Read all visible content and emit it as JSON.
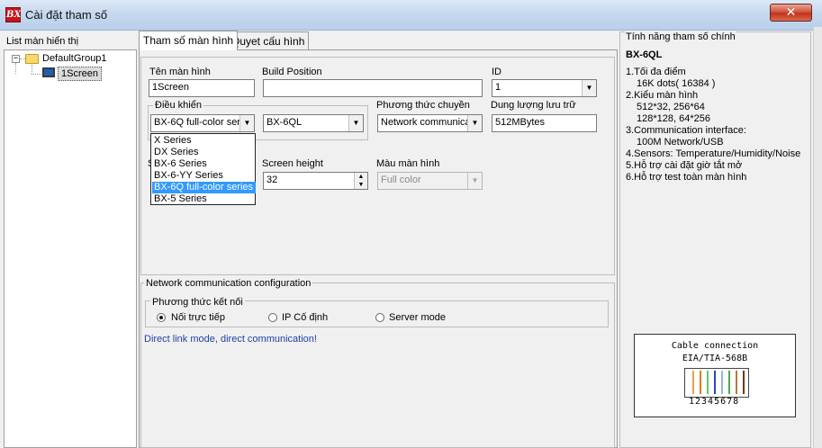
{
  "window": {
    "title": "Cài đặt tham số",
    "close_label": "✕",
    "app_icon_text": "BX"
  },
  "tree": {
    "label": "List màn hiển thị",
    "group": "DefaultGroup1",
    "screen": "1Screen",
    "collapse_glyph": "−"
  },
  "tabs": [
    {
      "label": "Tham số màn hình"
    },
    {
      "label": "Quyet cấu hình"
    }
  ],
  "form": {
    "screen_name": {
      "label": "Tên màn hình",
      "value": "1Screen"
    },
    "build_position": {
      "label": "Build Position",
      "value": ""
    },
    "id": {
      "label": "ID",
      "value": "1"
    },
    "control": {
      "label": "Điều khiển",
      "series_value": "BX-6Q full-color ser",
      "model_value": "BX-6QL"
    },
    "comm_method": {
      "label": "Phương thức chuyền",
      "value": "Network communica"
    },
    "storage": {
      "label": "Dung lượng lưu trữ",
      "value": "512MBytes"
    },
    "screen_width_label_partial": "S",
    "screen_height": {
      "label": "Screen height",
      "value": "32"
    },
    "screen_color": {
      "label": "Màu màn hình",
      "value": "Full color"
    }
  },
  "dropdown": {
    "options": [
      "X Series",
      "DX Series",
      "BX-6 Series",
      "BX-6-YY Series",
      "BX-6Q full-color series",
      "BX-5 Series"
    ],
    "selected_index": 4
  },
  "network": {
    "title": "Network communication configuration",
    "method_label": "Phương thức kết nối",
    "options": [
      "Nối trực tiếp",
      "IP Cố định",
      "Server mode"
    ],
    "selected_index": 0,
    "hint": "Direct link mode, direct communication!"
  },
  "features": {
    "title": "Tính năng tham số chính",
    "model": "BX-6QL",
    "lines": [
      "1.Tối đa điểm",
      "16K dots( 16384 )",
      "2.Kiểu màn hình",
      "512*32, 256*64",
      "128*128, 64*256",
      "3.Communication interface:",
      "100M Network/USB",
      "4.Sensors: Temperature/Humidity/Noise",
      "5.Hỗ trợ cài đặt giờ tắt mở",
      "6.Hỗ trợ test toàn màn hình"
    ],
    "cable_title": "Cable connection",
    "cable_std": "EIA/TIA-568B",
    "pins": "12345678",
    "wire_colors": [
      "#e9a24a",
      "#e07a1a",
      "#6cc26c",
      "#2348c9",
      "#9ab3e8",
      "#4aa84a",
      "#b47a3c",
      "#6b3a1a"
    ]
  },
  "colors": {
    "selection": "#3399ff",
    "hint_text": "#1f3fa8",
    "close": "#c0341c"
  }
}
